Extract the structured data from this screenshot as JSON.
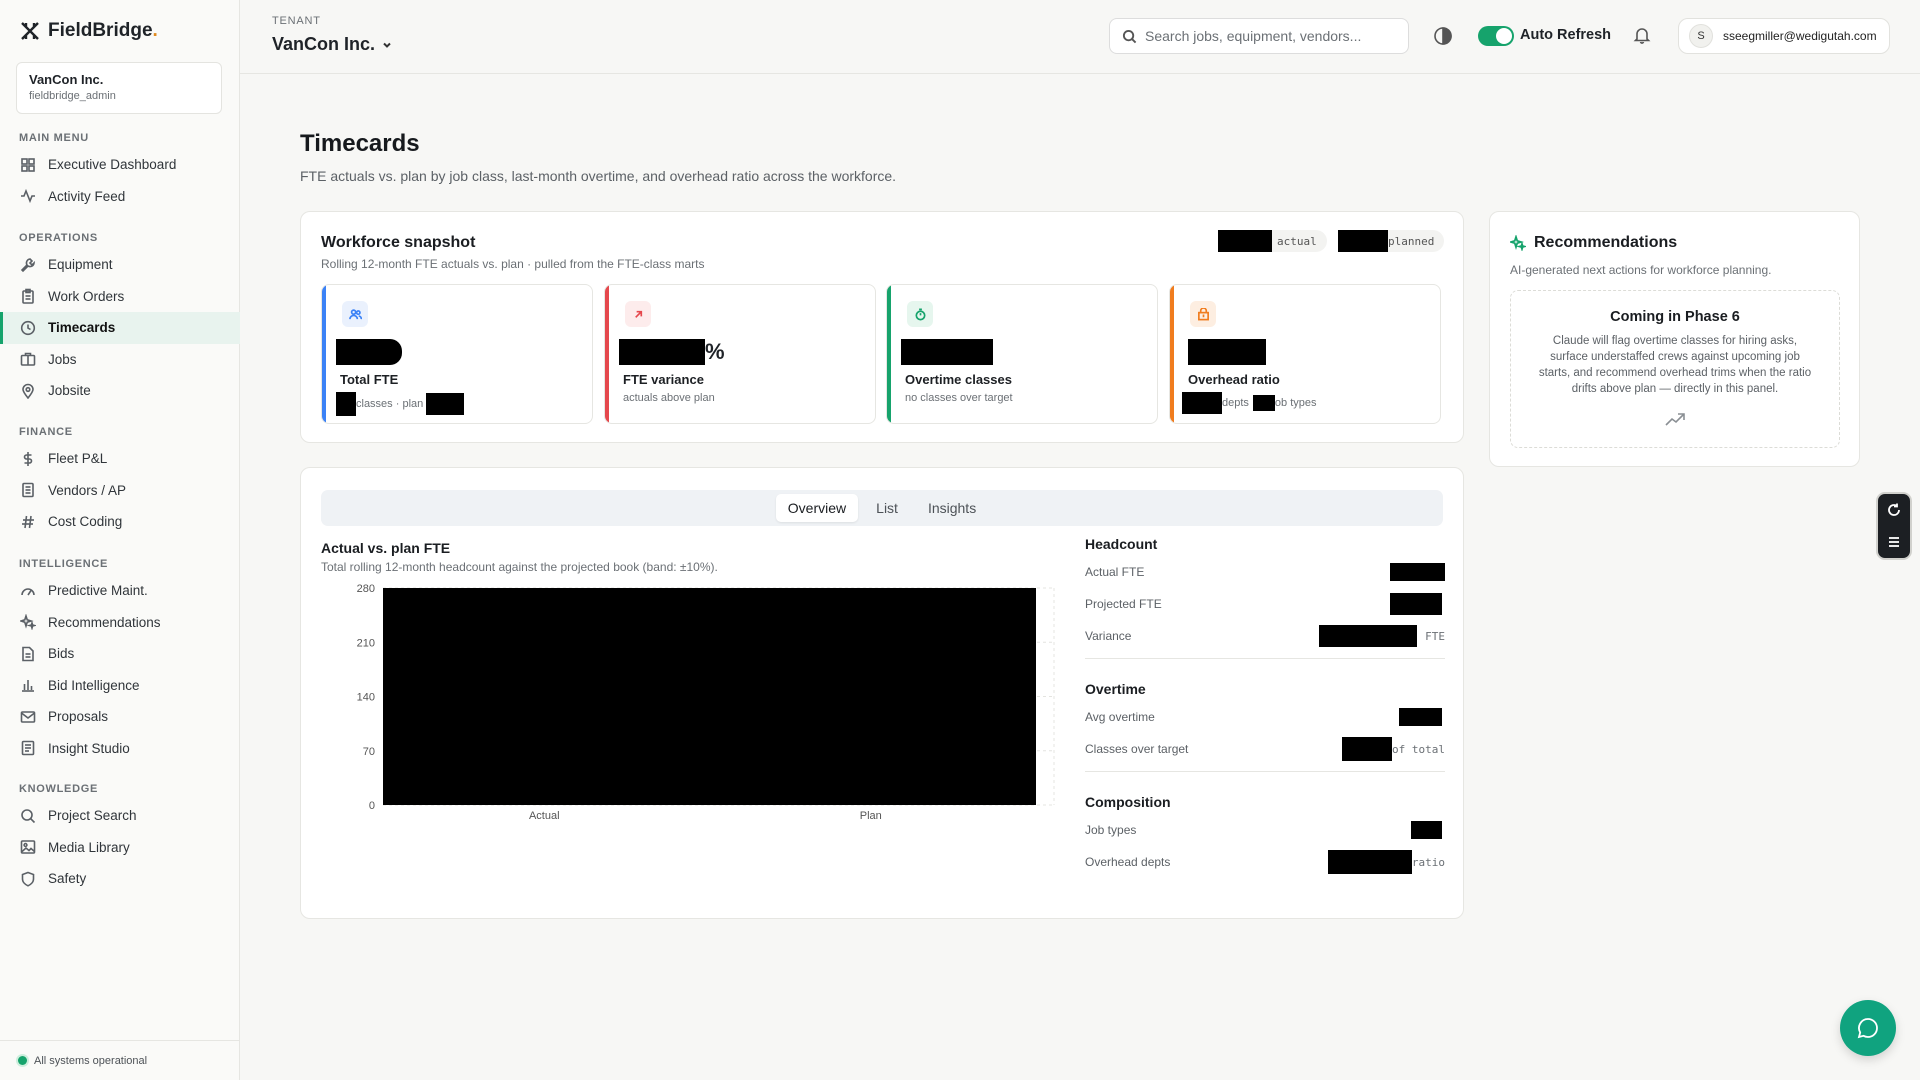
{
  "brand": {
    "name": "FieldBridge",
    "dot": "."
  },
  "sidebar": {
    "tenant_name": "VanCon Inc.",
    "tenant_user": "fieldbridge_admin",
    "sections": [
      {
        "heading": "MAIN MENU",
        "items": [
          {
            "label": "Executive Dashboard",
            "icon": "grid-icon"
          },
          {
            "label": "Activity Feed",
            "icon": "activity-icon"
          }
        ]
      },
      {
        "heading": "OPERATIONS",
        "items": [
          {
            "label": "Equipment",
            "icon": "wrench-icon"
          },
          {
            "label": "Work Orders",
            "icon": "clipboard-icon"
          },
          {
            "label": "Timecards",
            "icon": "clock-icon",
            "active": true
          },
          {
            "label": "Jobs",
            "icon": "briefcase-icon"
          },
          {
            "label": "Jobsite",
            "icon": "map-pin-icon"
          }
        ]
      },
      {
        "heading": "FINANCE",
        "items": [
          {
            "label": "Fleet P&L",
            "icon": "dollar-icon"
          },
          {
            "label": "Vendors / AP",
            "icon": "receipt-icon"
          },
          {
            "label": "Cost Coding",
            "icon": "hash-icon"
          }
        ]
      },
      {
        "heading": "INTELLIGENCE",
        "items": [
          {
            "label": "Predictive Maint.",
            "icon": "gauge-icon"
          },
          {
            "label": "Recommendations",
            "icon": "sparkles-icon"
          },
          {
            "label": "Bids",
            "icon": "file-icon"
          },
          {
            "label": "Bid Intelligence",
            "icon": "bar-chart-icon"
          },
          {
            "label": "Proposals",
            "icon": "mail-icon"
          },
          {
            "label": "Insight Studio",
            "icon": "document-icon"
          }
        ]
      },
      {
        "heading": "KNOWLEDGE",
        "items": [
          {
            "label": "Project Search",
            "icon": "search-icon"
          },
          {
            "label": "Media Library",
            "icon": "image-icon"
          },
          {
            "label": "Safety",
            "icon": "shield-icon"
          }
        ]
      }
    ],
    "status": "All systems operational"
  },
  "topbar": {
    "tenant_label": "TENANT",
    "tenant_value": "VanCon Inc.",
    "search_placeholder": "Search jobs, equipment, vendors...",
    "auto_refresh_label": "Auto Refresh",
    "auto_refresh_on": true,
    "avatar_initial": "S",
    "user_email": "sseegmiller@wedigutah.com"
  },
  "page": {
    "title": "Timecards",
    "subtitle": "FTE actuals vs. plan by job class, last-month overtime, and overhead ratio across the workforce."
  },
  "snapshot": {
    "title": "Workforce snapshot",
    "subtitle": "Rolling 12-month FTE actuals vs. plan · pulled from the FTE-class marts",
    "legend_actual": "actual",
    "legend_planned": "planned",
    "kpis": [
      {
        "label": "Total FTE",
        "foot_mid": "classes · plan",
        "icon": "users-icon",
        "accent": "#3b82f6"
      },
      {
        "label": "FTE variance",
        "value_suffix": "%",
        "foot": "actuals above plan",
        "icon": "arrow-up-right-icon",
        "accent": "#e5484d"
      },
      {
        "label": "Overtime classes",
        "foot": "no classes over target",
        "icon": "timer-icon",
        "accent": "#16a36c"
      },
      {
        "label": "Overhead ratio",
        "foot_mid": "depts",
        "foot_end": "ob types",
        "icon": "building-icon",
        "accent": "#f07c1e"
      }
    ]
  },
  "recommendations": {
    "title": "Recommendations",
    "subtitle": "AI-generated next actions for workforce planning.",
    "phase_title": "Coming in Phase 6",
    "phase_body": "Claude will flag overtime classes for hiring asks, surface understaffed crews against upcoming job starts, and recommend overhead trims when the ratio drifts above plan — directly in this panel."
  },
  "analysis": {
    "tabs": [
      "Overview",
      "List",
      "Insights"
    ],
    "active_tab": "Overview",
    "chart_title": "Actual vs. plan FTE",
    "chart_subtitle": "Total rolling 12-month headcount against the projected book (band: ±10%).",
    "stats": {
      "headcount_title": "Headcount",
      "actual_fte": "Actual FTE",
      "projected_fte": "Projected FTE",
      "variance": "Variance",
      "variance_unit": "FTE",
      "overtime_title": "Overtime",
      "avg_overtime": "Avg overtime",
      "classes_over_target": "Classes over target",
      "classes_unit": "of total",
      "composition_title": "Composition",
      "job_types": "Job types",
      "overhead_depts": "Overhead depts",
      "overhead_unit": "ratio"
    }
  },
  "chart_data": {
    "type": "bar",
    "title": "Actual vs. plan FTE",
    "categories": [
      "Actual",
      "Plan"
    ],
    "yticks": [
      0,
      70,
      140,
      210,
      280
    ],
    "ylim": [
      0,
      280
    ],
    "values_redacted": true
  }
}
